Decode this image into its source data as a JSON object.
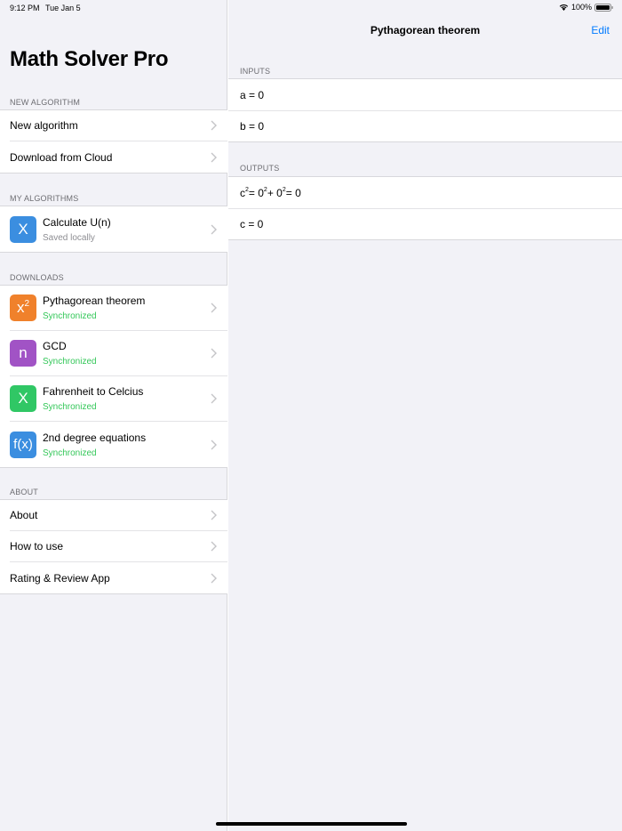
{
  "status": {
    "time": "9:12 PM",
    "date": "Tue Jan 5",
    "battery": "100%"
  },
  "sidebar": {
    "title": "Math Solver Pro",
    "sections": {
      "new": {
        "header": "NEW ALGORITHM",
        "items": [
          {
            "label": "New algorithm"
          },
          {
            "label": "Download from Cloud"
          }
        ]
      },
      "mine": {
        "header": "MY ALGORITHMS",
        "items": [
          {
            "icon": "X",
            "color": "#3b8ee0",
            "title": "Calculate U(n)",
            "subtitle": "Saved locally"
          }
        ]
      },
      "downloads": {
        "header": "DOWNLOADS",
        "items": [
          {
            "icon": "x",
            "icon_sup": "2",
            "color": "#f0812b",
            "title": "Pythagorean theorem",
            "subtitle": "Synchronized"
          },
          {
            "icon": "n",
            "color": "#a153c5",
            "title": "GCD",
            "subtitle": "Synchronized"
          },
          {
            "icon": "X",
            "color": "#30c765",
            "title": "Fahrenheit to Celcius",
            "subtitle": "Synchronized"
          },
          {
            "icon": "f(x)",
            "color": "#3b8ee0",
            "title": "2nd degree equations",
            "subtitle": "Synchronized"
          }
        ]
      },
      "about": {
        "header": "ABOUT",
        "items": [
          {
            "label": "About"
          },
          {
            "label": "How to use"
          },
          {
            "label": "Rating & Review App"
          }
        ]
      }
    }
  },
  "detail": {
    "title": "Pythagorean theorem",
    "edit_label": "Edit",
    "inputs_header": "INPUTS",
    "inputs": [
      "a = 0",
      "b = 0"
    ],
    "outputs_header": "OUTPUTS",
    "output_equation": {
      "c": "c",
      "exp1": "2",
      "eq1": " = 0",
      "exp2": "2",
      "plus": " + 0",
      "exp3": "2",
      "eq2": " = 0"
    },
    "output_result": "c = 0"
  }
}
